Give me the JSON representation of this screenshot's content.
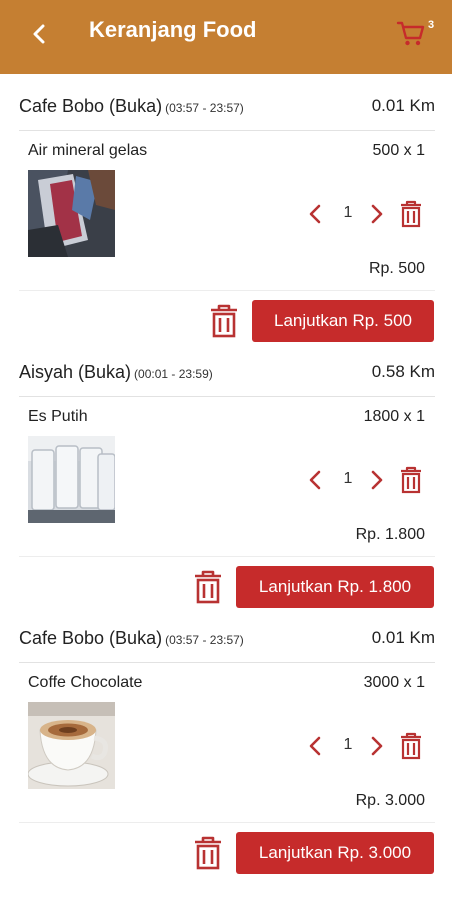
{
  "appbar": {
    "title": "Keranjang Food",
    "cart_count": "3"
  },
  "stores": [
    {
      "name": "Cafe Bobo (Buka)",
      "hours": "(03:57 - 23:57)",
      "distance": "0.01 Km",
      "item": {
        "name": "Air mineral gelas",
        "price_qty": "500 x 1",
        "quantity": "1",
        "subtotal": "Rp. 500"
      },
      "checkout_label": "Lanjutkan Rp. 500"
    },
    {
      "name": "Aisyah (Buka)",
      "hours": "(00:01 - 23:59)",
      "distance": "0.58 Km",
      "item": {
        "name": "Es Putih",
        "price_qty": "1800 x 1",
        "quantity": "1",
        "subtotal": "Rp. 1.800"
      },
      "checkout_label": "Lanjutkan Rp. 1.800"
    },
    {
      "name": "Cafe Bobo (Buka)",
      "hours": "(03:57 - 23:57)",
      "distance": "0.01 Km",
      "item": {
        "name": "Coffe Chocolate",
        "price_qty": "3000 x 1",
        "quantity": "1",
        "subtotal": "Rp. 3.000"
      },
      "checkout_label": "Lanjutkan Rp. 3.000"
    }
  ],
  "colors": {
    "appbar": "#c57f32",
    "accent": "#c62b2b",
    "icon_red": "#b83232"
  },
  "icons": {
    "back": "chevron-left-icon",
    "cart": "cart-icon",
    "decrement": "chevron-left-icon",
    "increment": "chevron-right-icon",
    "delete": "trash-icon"
  }
}
